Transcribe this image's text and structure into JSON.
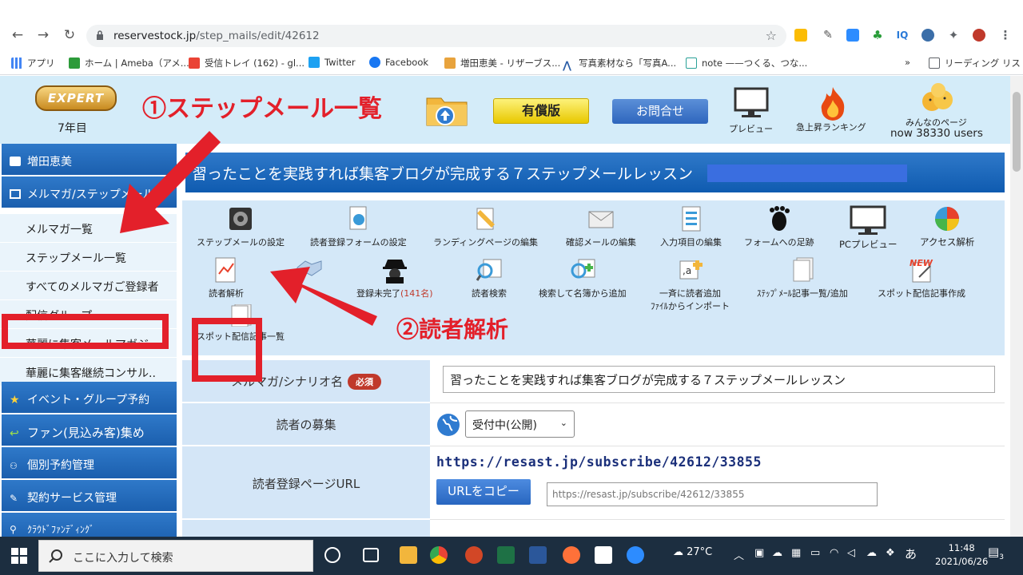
{
  "browser": {
    "url_host": "reservestock.jp",
    "url_path": "/step_mails/edit/42612",
    "bookmarks": [
      "アプリ",
      "ホーム | Ameba（アメ...",
      "受信トレイ (162) - gl...",
      "Twitter",
      "Facebook",
      "増田恵美 - リザーブス...",
      "写真素材なら「写真A...",
      "note ——つくる、つな...",
      "»",
      "リーディング リスト"
    ]
  },
  "header": {
    "years": "7年目",
    "paid_label": "有償版",
    "contact_label": "お問合せ",
    "preview_label": "プレビュー",
    "ranking_label": "急上昇ランキング",
    "everyone_label": "みんなのページ",
    "users_text": "now 38330 users"
  },
  "sidebar": {
    "user": "増田恵美",
    "section": "メルマガ/ステップメール",
    "subs": [
      "メルマガ一覧",
      "ステップメール一覧",
      "すべてのメルマガご登録者",
      "配信グループ",
      "華麗に集客メールマガジ..",
      "華麗に集客継続コンサル.."
    ],
    "mains": [
      "イベント・グループ予約",
      "ファン(見込み客)集め",
      "個別予約管理",
      "契約サービス管理",
      "ｸﾗｳﾄﾞﾌｧﾝﾃﾞｨﾝｸﾞ"
    ]
  },
  "title": "習ったことを実践すれば集客ブログが完成する７ステップメールレッスン",
  "tools": {
    "row1": [
      "ステップメールの設定",
      "読者登録フォームの設定",
      "ランディングページの編集",
      "確認メールの編集",
      "入力項目の編集",
      "フォームへの足跡",
      "PCプレビュー",
      "アクセス解析"
    ],
    "row2": [
      "読者解析",
      "登録未完了",
      "(141名)",
      "読者検索",
      "検索して名簿から追加",
      "一斉に読者追加",
      "ﾌｧｲﾙからインポート",
      "ｽﾃｯﾌﾟﾒｰﾙ記事一覧/追加",
      "スポット配信記事作成"
    ],
    "row3": [
      "スポット配信記事一覧"
    ]
  },
  "form": {
    "name_label": "メルマガ/シナリオ名",
    "required_badge": "必須",
    "name_value": "習ったことを実践すれば集客ブログが完成する７ステップメールレッスン",
    "recruit_label": "読者の募集",
    "recruit_value": "受付中(公開)",
    "url_label": "読者登録ページURL",
    "subscribe_link": "https://resast.jp/subscribe/42612/33855",
    "copy_label": "URLをコピー",
    "url_field_value": "https://resast.jp/subscribe/42612/33855"
  },
  "annotations": {
    "a1": "①ステップメール一覧",
    "a2": "②読者解析"
  },
  "taskbar": {
    "search_placeholder": "ここに入力して検索",
    "temperature": "27°C",
    "ime": "あ",
    "time": "11:48",
    "date": "2021/06/26",
    "notifications": "3"
  },
  "colors": {
    "annotation": "#e3202a",
    "sidebar": "#1b5fae",
    "title_bar": "#0f5bb0"
  }
}
